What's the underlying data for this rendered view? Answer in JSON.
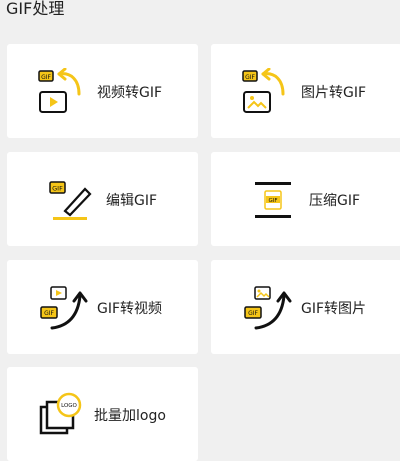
{
  "section": {
    "title": "GIF处理"
  },
  "tools": [
    {
      "label": "视频转GIF",
      "icon": "video-to-gif-icon"
    },
    {
      "label": "图片转GIF",
      "icon": "image-to-gif-icon"
    },
    {
      "label": "编辑GIF",
      "icon": "edit-gif-icon"
    },
    {
      "label": "压缩GIF",
      "icon": "compress-gif-icon"
    },
    {
      "label": "GIF转视频",
      "icon": "gif-to-video-icon"
    },
    {
      "label": "GIF转图片",
      "icon": "gif-to-image-icon"
    },
    {
      "label": "批量加logo",
      "icon": "batch-logo-icon"
    }
  ],
  "icon_text": {
    "gif": "GIF",
    "logo": "LOGO"
  },
  "colors": {
    "accent": "#f5c518",
    "stroke": "#111111",
    "card": "#ffffff",
    "background": "#f0f0f0"
  }
}
